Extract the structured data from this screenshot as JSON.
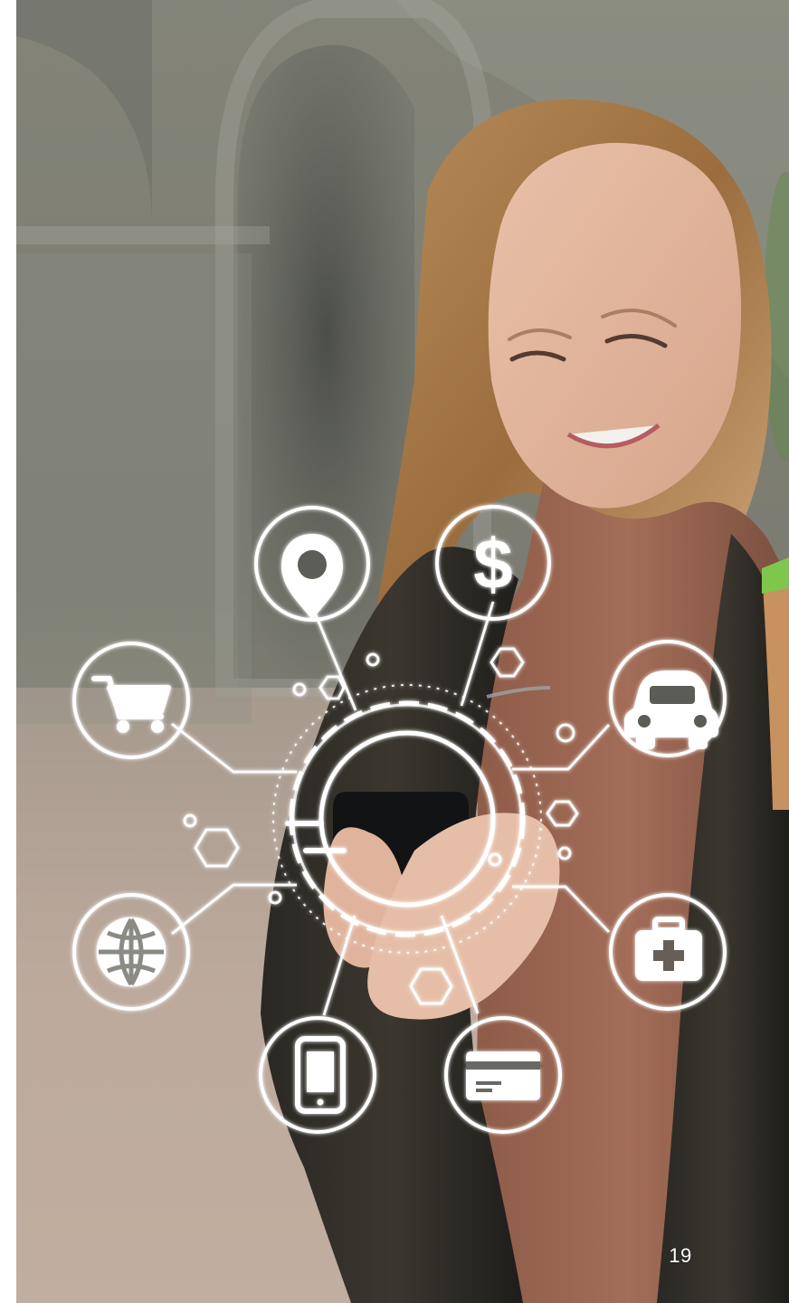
{
  "page": {
    "page_number": "19"
  },
  "hero_image": {
    "icons": [
      "location-pin-icon",
      "dollar-icon",
      "shopping-cart-icon",
      "car-icon",
      "globe-icon",
      "first-aid-kit-icon",
      "smartphone-icon",
      "credit-card-icon"
    ],
    "colors": {
      "overlay_white": "#ffffff",
      "sweater_brown": "#8c5b48",
      "jacket_dark": "#2e2c27",
      "cup_green": "#7fc64d"
    }
  }
}
